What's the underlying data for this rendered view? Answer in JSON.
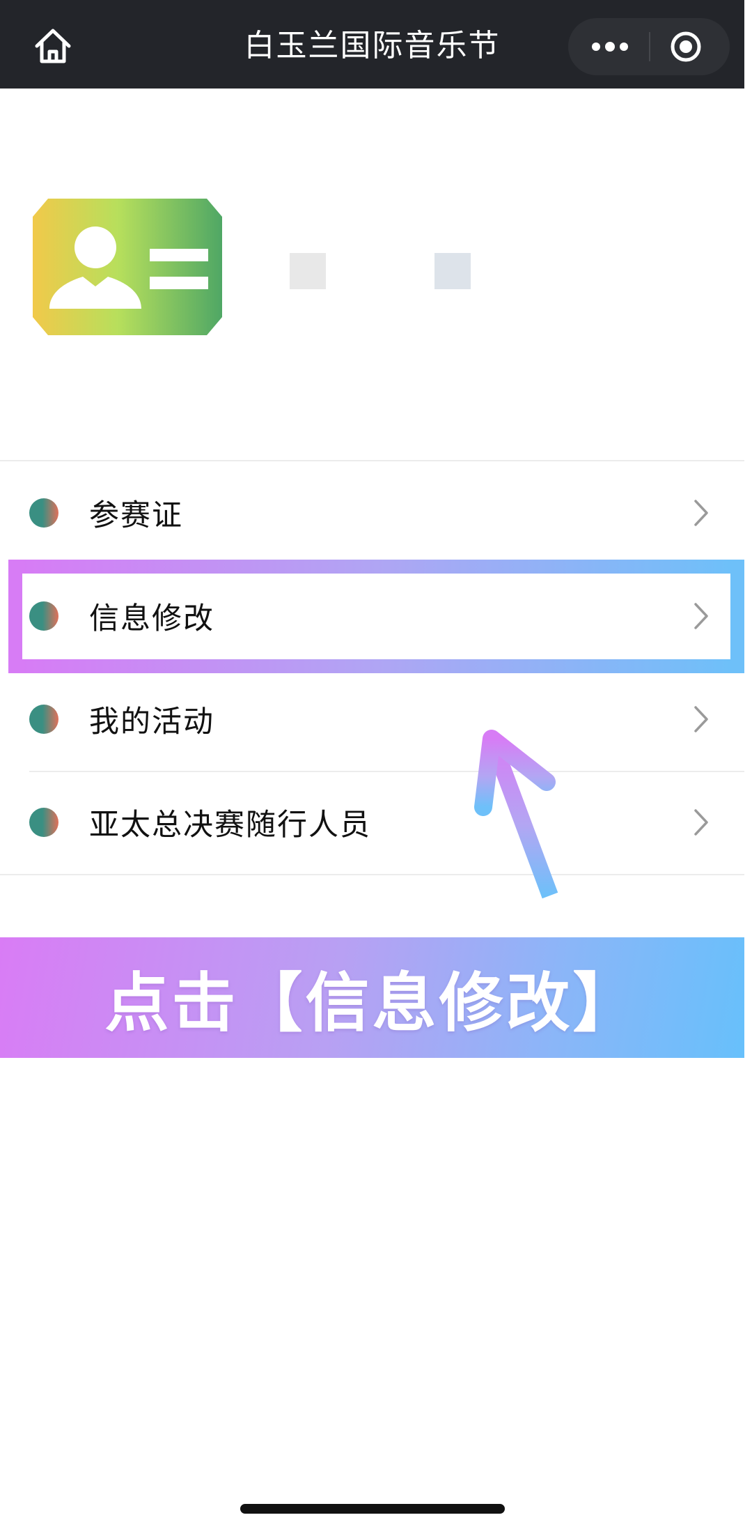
{
  "nav": {
    "title": "白玉兰国际音乐节"
  },
  "icons": {
    "home": "home-icon",
    "more": "more-dots-icon",
    "close": "target-circle-icon",
    "id_card": "id-card-icon",
    "chevron": "chevron-right-icon",
    "arrow": "pointer-arrow-icon"
  },
  "menu": {
    "items": [
      {
        "label": "参赛证"
      },
      {
        "label": "信息修改"
      },
      {
        "label": "我的活动"
      },
      {
        "label": "亚太总决赛随行人员"
      }
    ]
  },
  "banner": {
    "text": "点击【信息修改】"
  },
  "colors": {
    "nav_bg": "#23252a",
    "highlight_start": "#d77cf5",
    "highlight_end": "#6ec0f9",
    "dot_green": "#3a8f82",
    "dot_orange": "#e0715a"
  }
}
